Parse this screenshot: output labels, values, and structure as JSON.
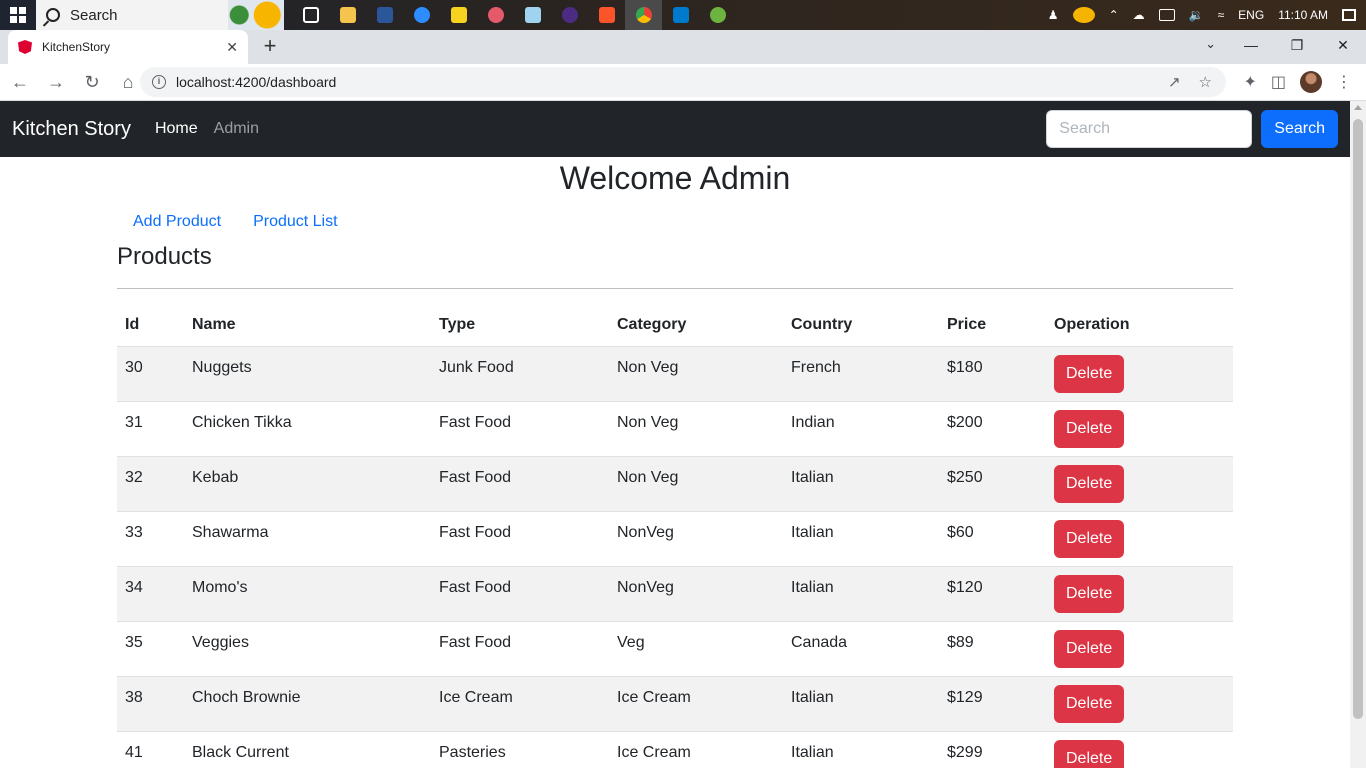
{
  "taskbar": {
    "search_label": "Search",
    "language": "ENG",
    "time": "11:10 AM"
  },
  "browser": {
    "tab_title": "KitchenStory",
    "url": "localhost:4200/dashboard"
  },
  "navbar": {
    "brand": "Kitchen Story",
    "links": [
      "Home",
      "Admin"
    ],
    "search_placeholder": "Search",
    "search_button": "Search"
  },
  "page": {
    "welcome": "Welcome Admin",
    "admin_links": [
      "Add Product",
      "Product List"
    ],
    "section_title": "Products"
  },
  "table": {
    "headers": [
      "Id",
      "Name",
      "Type",
      "Category",
      "Country",
      "Price",
      "Operation"
    ],
    "delete_label": "Delete",
    "rows": [
      {
        "id": "30",
        "name": "Nuggets",
        "type": "Junk Food",
        "category": "Non Veg",
        "country": "French",
        "price": "$180"
      },
      {
        "id": "31",
        "name": "Chicken Tikka",
        "type": "Fast Food",
        "category": "Non Veg",
        "country": "Indian",
        "price": "$200"
      },
      {
        "id": "32",
        "name": "Kebab",
        "type": "Fast Food",
        "category": "Non Veg",
        "country": "Italian",
        "price": "$250"
      },
      {
        "id": "33",
        "name": "Shawarma",
        "type": "Fast Food",
        "category": "NonVeg",
        "country": "Italian",
        "price": "$60"
      },
      {
        "id": "34",
        "name": "Momo's",
        "type": "Fast Food",
        "category": "NonVeg",
        "country": "Italian",
        "price": "$120"
      },
      {
        "id": "35",
        "name": "Veggies",
        "type": "Fast Food",
        "category": "Veg",
        "country": "Canada",
        "price": "$89"
      },
      {
        "id": "38",
        "name": "Choch Brownie",
        "type": "Ice Cream",
        "category": "Ice Cream",
        "country": "Italian",
        "price": "$129"
      },
      {
        "id": "41",
        "name": "Black Current",
        "type": "Pasteries",
        "category": "Ice Cream",
        "country": "Italian",
        "price": "$299"
      }
    ]
  },
  "colors": {
    "navbar_bg": "#212529",
    "primary": "#0d6efd",
    "danger": "#dc3545",
    "striped_row": "#f2f2f2"
  }
}
